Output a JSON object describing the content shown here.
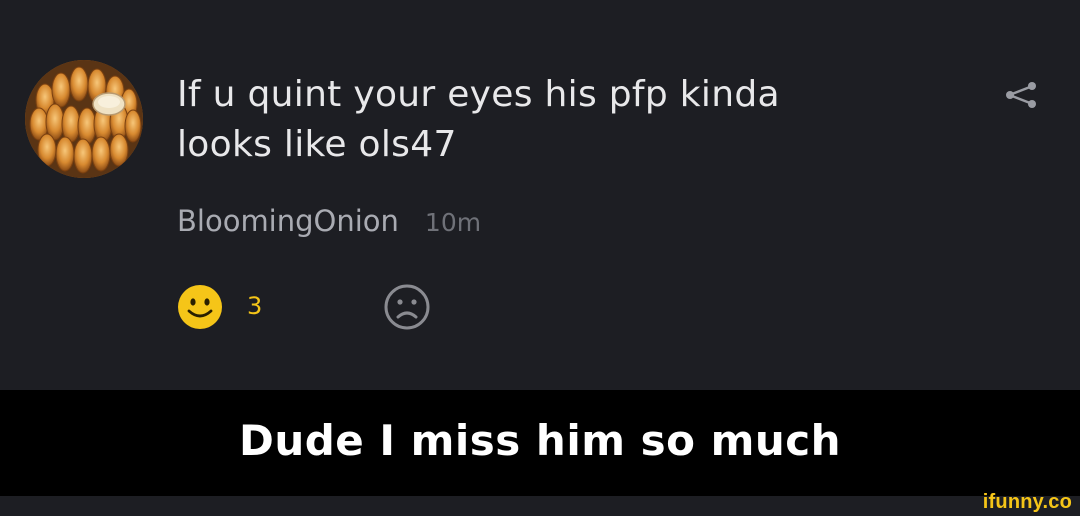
{
  "comment": {
    "text_line1": "If u quint your eyes his pfp kinda",
    "text_line2": "looks like ols47",
    "username": "BloomingOnion",
    "time": "10m",
    "avatar_icon": "blooming-onion-avatar",
    "share_icon": "share-icon"
  },
  "reactions": {
    "smile_count": "3",
    "smile_icon": "smile-emoji-icon",
    "frown_icon": "frown-face-icon",
    "smile_color": "#f5c518",
    "frown_color": "#8a8b91"
  },
  "caption": {
    "text": "Dude I miss him so much"
  },
  "watermark": {
    "text": "ifunny.co"
  },
  "colors": {
    "background": "#1d1e23",
    "caption_bar": "#000000",
    "text_primary": "#e8e8ea",
    "text_secondary": "#a9abb2",
    "text_muted": "#6f7178",
    "accent": "#f5c518"
  }
}
